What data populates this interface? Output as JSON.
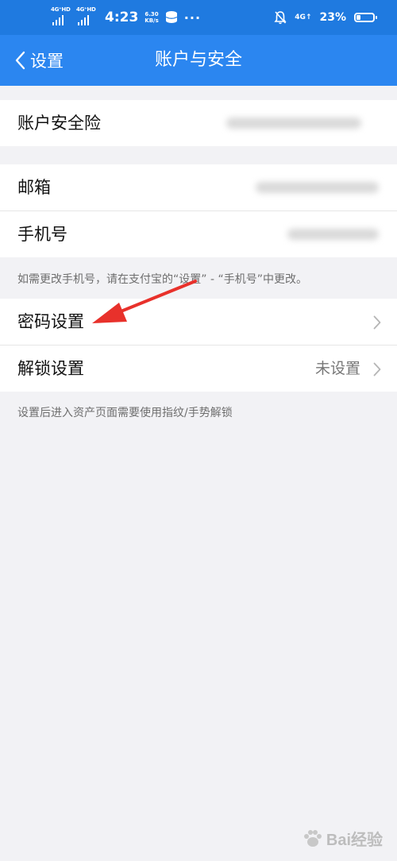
{
  "status_bar": {
    "sim1_tag": "4G⁺HD",
    "sim2_tag": "4G⁺HD",
    "time": "4:23",
    "speed_value": "6.30",
    "speed_unit": "KB/s",
    "more_dots": "···",
    "net_tag": "4G",
    "battery_percent": "23%",
    "battery_level": 0.23
  },
  "navbar": {
    "back_label": "设置",
    "title": "账户与安全"
  },
  "groups": {
    "g1": {
      "insurance_label": "账户安全险"
    },
    "g2": {
      "email_label": "邮箱",
      "phone_label": "手机号"
    },
    "phone_hint": "如需更改手机号，请在支付宝的“设置” - “手机号”中更改。",
    "g3": {
      "password_label": "密码设置",
      "unlock_label": "解锁设置",
      "unlock_value": "未设置"
    },
    "unlock_hint": "设置后进入资产页面需要使用指纹/手势解锁"
  },
  "watermark": {
    "text": "Bai经验"
  },
  "colors": {
    "status_bar": "#1f7ae0",
    "navbar": "#2b86f0",
    "arrow": "#e8312b",
    "background": "#f2f2f5"
  }
}
